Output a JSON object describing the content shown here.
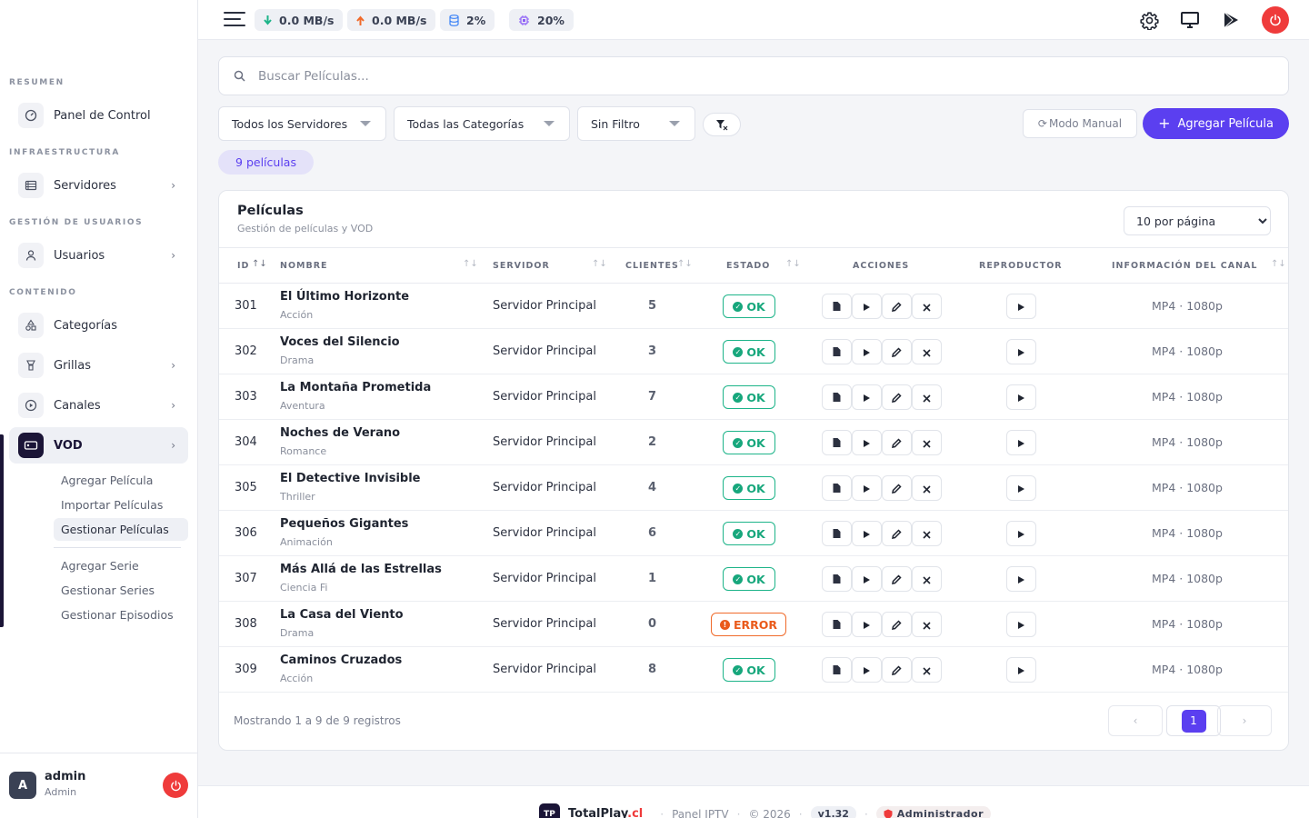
{
  "topbar": {
    "stats": [
      {
        "icon": "arrow-down-icon",
        "value": "0.0 MB/s",
        "color": "#1db489"
      },
      {
        "icon": "arrow-up-icon",
        "value": "0.0 MB/s",
        "color": "#f06a2a"
      },
      {
        "icon": "database-icon",
        "value": "2%",
        "color": "#3b82f6"
      },
      {
        "icon": "cpu-icon",
        "value": "20%",
        "color": "#8b5cf6"
      }
    ]
  },
  "sidebar": {
    "sections": {
      "resumen": "RESUMEN",
      "infra": "INFRAESTRUCTURA",
      "usuarios": "GESTIÓN DE USUARIOS",
      "contenido": "CONTENIDO"
    },
    "items": {
      "panel": "Panel de Control",
      "servidores": "Servidores",
      "usuarios": "Usuarios",
      "categorias": "Categorías",
      "grillas": "Grillas",
      "canales": "Canales",
      "vod": "VOD"
    },
    "vod_sub": [
      "Agregar Película",
      "Importar Películas",
      "Gestionar Películas",
      "Agregar Serie",
      "Gestionar Series",
      "Gestionar Episodios"
    ],
    "user": {
      "initial": "A",
      "name": "admin",
      "role": "Admin"
    }
  },
  "search": {
    "placeholder": "Buscar Películas..."
  },
  "filters": {
    "servers": "Todos los Servidores",
    "categories": "Todas las Categorías",
    "filter": "Sin Filtro",
    "manual": "Modo Manual",
    "add": "Agregar Película"
  },
  "count_badge": "9 películas",
  "card": {
    "title": "Películas",
    "subtitle": "Gestión de películas y VOD",
    "per_page": "10 por página",
    "columns": {
      "id": "ID",
      "name": "NOMBRE",
      "server": "SERVIDOR",
      "clients": "CLIENTES",
      "status": "ESTADO",
      "actions": "ACCIONES",
      "player": "REPRODUCTOR",
      "info": "INFORMACIÓN DEL CANAL"
    },
    "rows": [
      {
        "id": "301",
        "name": "El Último Horizonte",
        "category": "Acción",
        "server": "Servidor Principal",
        "clients": "5",
        "status": "OK",
        "info": "MP4 · 1080p"
      },
      {
        "id": "302",
        "name": "Voces del Silencio",
        "category": "Drama",
        "server": "Servidor Principal",
        "clients": "3",
        "status": "OK",
        "info": "MP4 · 1080p"
      },
      {
        "id": "303",
        "name": "La Montaña Prometida",
        "category": "Aventura",
        "server": "Servidor Principal",
        "clients": "7",
        "status": "OK",
        "info": "MP4 · 1080p"
      },
      {
        "id": "304",
        "name": "Noches de Verano",
        "category": "Romance",
        "server": "Servidor Principal",
        "clients": "2",
        "status": "OK",
        "info": "MP4 · 1080p"
      },
      {
        "id": "305",
        "name": "El Detective Invisible",
        "category": "Thriller",
        "server": "Servidor Principal",
        "clients": "4",
        "status": "OK",
        "info": "MP4 · 1080p"
      },
      {
        "id": "306",
        "name": "Pequeños Gigantes",
        "category": "Animación",
        "server": "Servidor Principal",
        "clients": "6",
        "status": "OK",
        "info": "MP4 · 1080p"
      },
      {
        "id": "307",
        "name": "Más Allá de las Estrellas",
        "category": "Ciencia Fi",
        "server": "Servidor Principal",
        "clients": "1",
        "status": "OK",
        "info": "MP4 · 1080p"
      },
      {
        "id": "308",
        "name": "La Casa del Viento",
        "category": "Drama",
        "server": "Servidor Principal",
        "clients": "0",
        "status": "ERROR",
        "info": "MP4 · 1080p"
      },
      {
        "id": "309",
        "name": "Caminos Cruzados",
        "category": "Acción",
        "server": "Servidor Principal",
        "clients": "8",
        "status": "OK",
        "info": "MP4 · 1080p"
      }
    ],
    "footer": "Mostrando 1 a 9 de 9 registros",
    "pagination": {
      "prev": "‹",
      "current": "1",
      "next": "›"
    }
  },
  "page_footer": {
    "logo": "TP",
    "brand_main": "TotalPlay",
    "brand_accent": ".cl",
    "product": "Panel IPTV",
    "copyright": "© 2026",
    "version": "v1.32",
    "role": "Administrador"
  },
  "colors": {
    "accent": "#5b3ff0",
    "ok": "#17a77c",
    "error": "#ea5a1a",
    "danger": "#ef3b3b",
    "brand_dark": "#1b1537"
  }
}
